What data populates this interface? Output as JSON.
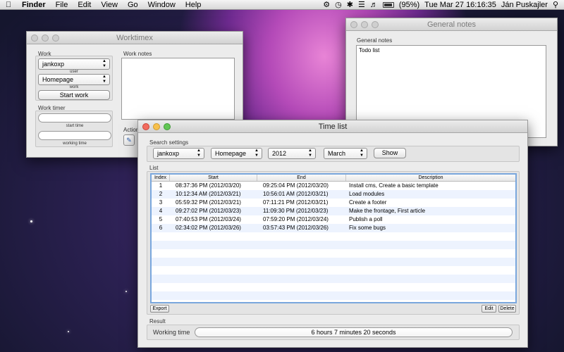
{
  "menubar": {
    "app_name": "Finder",
    "items": [
      "File",
      "Edit",
      "View",
      "Go",
      "Window",
      "Help"
    ],
    "battery": "(95%)",
    "clock": "Tue Mar 27  16:16:35",
    "user": "Ján Puskajler"
  },
  "worktimex": {
    "title": "Worktimex",
    "work_label": "Work",
    "user_select": "jankoxp",
    "user_caption": "user",
    "work_select": "Homepage",
    "work_caption": "work",
    "start_button": "Start work",
    "timer_label": "Work timer",
    "start_time_caption": "start time",
    "working_time_caption": "working time",
    "notes_label": "Work notes",
    "action_label": "Action"
  },
  "general_notes": {
    "title": "General notes",
    "label": "General notes",
    "content": "Todo list"
  },
  "time_list": {
    "title": "Time list",
    "search_label": "Search settings",
    "filters": {
      "user": "jankoxp",
      "project": "Homepage",
      "year": "2012",
      "month": "March"
    },
    "show_button": "Show",
    "list_label": "List",
    "columns": [
      "Index",
      "Start",
      "End",
      "Description"
    ],
    "rows": [
      {
        "index": "1",
        "start": "08:37:36 PM (2012/03/20)",
        "end": "09:25:04 PM (2012/03/20)",
        "desc": "Install cms, Create a basic template"
      },
      {
        "index": "2",
        "start": "10:12:34 AM (2012/03/21)",
        "end": "10:56:01 AM (2012/03/21)",
        "desc": "Load modules"
      },
      {
        "index": "3",
        "start": "05:59:32 PM (2012/03/21)",
        "end": "07:11:21 PM (2012/03/21)",
        "desc": "Create a footer"
      },
      {
        "index": "4",
        "start": "09:27:02 PM (2012/03/23)",
        "end": "11:09:30 PM (2012/03/23)",
        "desc": "Make the frontage, First article"
      },
      {
        "index": "5",
        "start": "07:40:53 PM (2012/03/24)",
        "end": "07:59:20 PM (2012/03/24)",
        "desc": "Publish a poll"
      },
      {
        "index": "6",
        "start": "02:34:02 PM (2012/03/26)",
        "end": "03:57:43 PM (2012/03/26)",
        "desc": "Fix some bugs"
      }
    ],
    "export_button": "Export",
    "edit_button": "Edit",
    "delete_button": "Delete",
    "result_label": "Result",
    "working_time_label": "Working time",
    "working_time_value": "6 hours 7 minutes 20 seconds"
  }
}
